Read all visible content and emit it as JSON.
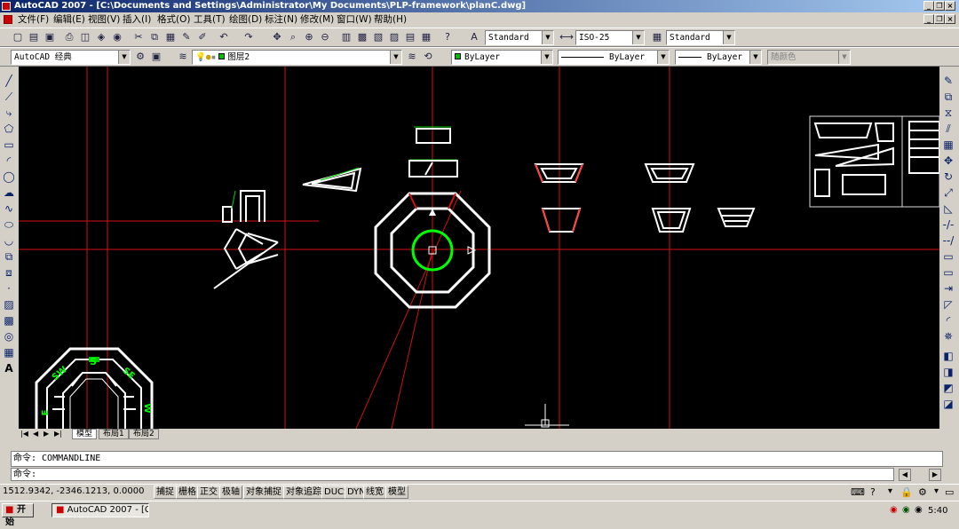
{
  "window": {
    "title": "AutoCAD 2007 - [C:\\Documents and Settings\\Administrator\\My Documents\\PLP-framework\\planC.dwg]"
  },
  "menu": [
    "文件(F)",
    "编辑(E)",
    "视图(V)",
    "插入(I)",
    "格式(O)",
    "工具(T)",
    "绘图(D)",
    "标注(N)",
    "修改(M)",
    "窗口(W)",
    "帮助(H)"
  ],
  "toolbar": {
    "text_style": "Standard",
    "dim_style": "ISO-25",
    "table_style": "Standard",
    "workspace": "AutoCAD 经典",
    "layer": "图层2",
    "color": "ByLayer",
    "linetype": "ByLayer",
    "lineweight": "ByLayer",
    "plotstyle": "随颜色"
  },
  "tabs": [
    "模型",
    "布局1",
    "布局2"
  ],
  "active_tab": "模型",
  "drawing": {
    "labels": [
      "S",
      "SE",
      "SW",
      "E",
      "W"
    ]
  },
  "command": {
    "history": "命令: COMMANDLINE",
    "prompt": "命令:"
  },
  "status": {
    "coords": "1512.9342,  -2346.1213, 0.0000",
    "toggles": [
      "捕捉",
      "栅格",
      "正交",
      "极轴",
      "对象捕捉",
      "对象追踪",
      "DUCS",
      "DYN",
      "线宽",
      "模型"
    ]
  },
  "taskbar": {
    "start": "开始",
    "task": "AutoCAD 2007 - [C:\\Doc...",
    "clock": "5:40"
  },
  "colors": {
    "canvas": "#000000",
    "axis": "#ff0000",
    "geometry": "#ffffff",
    "highlight": "#00ff00",
    "red_edge": "#ff4040"
  }
}
